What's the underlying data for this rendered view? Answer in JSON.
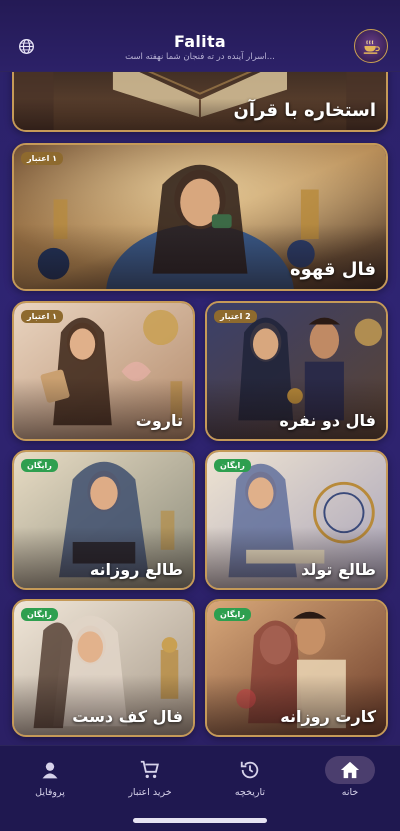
{
  "header": {
    "title": "Falita",
    "subtitle": "اسرار آینده در ته فنجان شما نهفته است...",
    "globe_icon": "globe-icon",
    "logo_icon": "coffee-cup-logo"
  },
  "cards": {
    "istikhara": {
      "title": "استخاره با قرآن"
    },
    "coffee": {
      "title": "فال قهوه",
      "badge": "۱ اعتبار"
    },
    "couple": {
      "title": "فال دو نفره",
      "badge": "2 اعتبار"
    },
    "tarot": {
      "title": "تاروت",
      "badge": "۱ اعتبار"
    },
    "birth": {
      "title": "طالع تولد",
      "badge": "رایگان"
    },
    "daily_horoscope": {
      "title": "طالع روزانه",
      "badge": "رایگان"
    },
    "daily_card": {
      "title": "کارت روزانه",
      "badge": "رایگان"
    },
    "palm": {
      "title": "فال کف دست",
      "badge": "رایگان"
    }
  },
  "nav": {
    "home": "خانه",
    "history": "تاریخچه",
    "buy": "خرید اعتبار",
    "profile": "پروفایل"
  },
  "colors": {
    "background": "#2a1f62",
    "card_border": "#c59a58",
    "badge_free": "#2e9f4f",
    "badge_credit": "#8e6a2e",
    "nav_bg": "#1f1850"
  }
}
